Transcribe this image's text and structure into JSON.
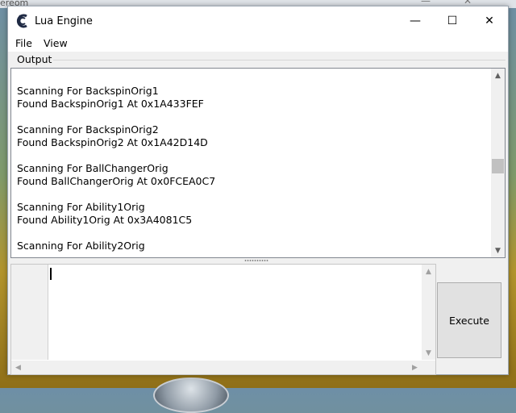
{
  "background": {
    "other_window_title": "ereom"
  },
  "window": {
    "title": "Lua Engine",
    "controls": {
      "minimize": "—",
      "maximize": "☐",
      "close": "✕"
    },
    "icon": "cheat-engine-logo-icon",
    "accent_color": "#1f2a44"
  },
  "menu": {
    "file": "File",
    "view": "View"
  },
  "output": {
    "label": "Output",
    "lines": [
      "Scanning For BackspinOrig1",
      "Found BackspinOrig1 At 0x1A433FEF",
      "",
      "Scanning For BackspinOrig2",
      "Found BackspinOrig2 At 0x1A42D14D",
      "",
      "Scanning For BallChangerOrig",
      "Found BallChangerOrig At 0x0FCEA0C7",
      "",
      "Scanning For Ability1Orig",
      "Found Ability1Orig At 0x3A4081C5",
      "",
      "Scanning For Ability2Orig"
    ]
  },
  "editor": {
    "content": ""
  },
  "execute_button": {
    "label": "Execute"
  }
}
